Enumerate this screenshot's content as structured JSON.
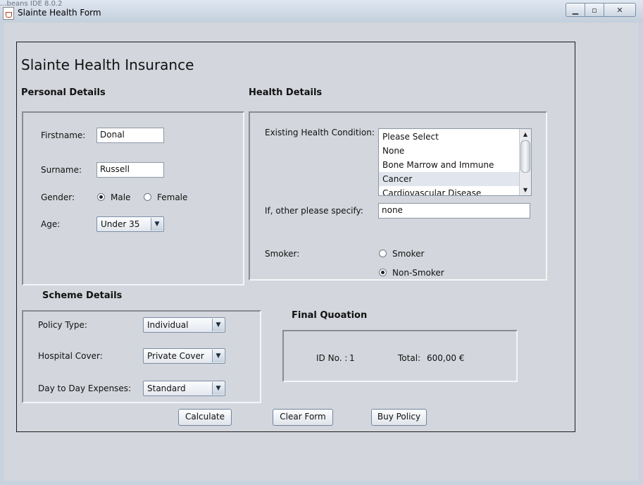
{
  "window": {
    "ghost_text": "...beans IDE 8.0.2",
    "title": "Slainte Health Form"
  },
  "app_title": "Slainte Health Insurance",
  "personal": {
    "heading": "Personal Details",
    "firstname_label": "Firstname:",
    "firstname_value": "Donal",
    "surname_label": "Surname:",
    "surname_value": "Russell",
    "gender_label": "Gender:",
    "gender_male": "Male",
    "gender_female": "Female",
    "gender_selected": "Male",
    "age_label": "Age:",
    "age_value": "Under 35"
  },
  "health": {
    "heading": "Health Details",
    "condition_label": "Existing Health Condition:",
    "conditions": [
      "Please Select",
      "None",
      "Bone Marrow and Immune System",
      "Cancer",
      "Cardiovascular Disease"
    ],
    "selected_condition": "Cancer",
    "other_label": "If, other please specify:",
    "other_value": "none",
    "smoker_label": "Smoker:",
    "smoker_opt": "Smoker",
    "nonsmoker_opt": "Non-Smoker",
    "smoker_selected": "Non-Smoker"
  },
  "scheme": {
    "heading": "Scheme Details",
    "policy_label": "Policy Type:",
    "policy_value": "Individual",
    "hospital_label": "Hospital Cover:",
    "hospital_value": "Private Cover",
    "daily_label": "Day to Day Expenses:",
    "daily_value": "Standard"
  },
  "quote": {
    "heading": "Final Quoation",
    "id_label": "ID No. :",
    "id_value": "1",
    "total_label": "Total:",
    "total_value": "600,00 €"
  },
  "buttons": {
    "calculate": "Calculate",
    "clear": "Clear Form",
    "buy": "Buy Policy"
  },
  "icons": {
    "app": "java-cup-icon",
    "minimize": "minimize-icon",
    "maximize": "maximize-icon",
    "close": "close-icon"
  }
}
